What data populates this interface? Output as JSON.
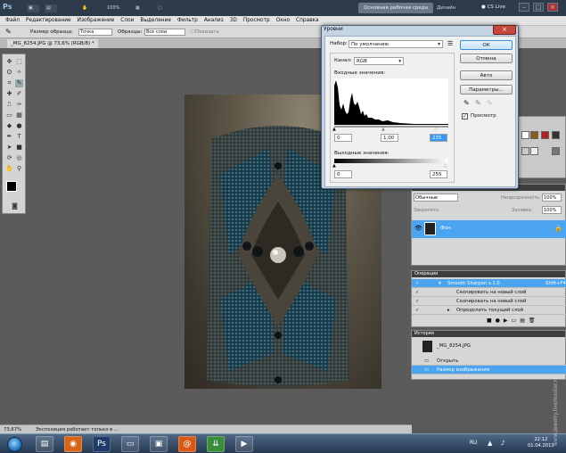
{
  "app": {
    "logo": "Ps",
    "zoom": "100%",
    "workspace_label": "Основная рабочая среда",
    "design_label": "Дизайн",
    "cslive": "CS Live"
  },
  "menu": [
    "Файл",
    "Редактирование",
    "Изображение",
    "Слои",
    "Выделение",
    "Фильтр",
    "Анализ",
    "3D",
    "Просмотр",
    "Окно",
    "Справка"
  ],
  "options": {
    "sample_size_label": "Размер образца:",
    "sample_size_value": "Точка",
    "samples_label": "Образцы:",
    "samples_value": "Все слои",
    "ring_label": "Показать кольцо пробы"
  },
  "document": {
    "tab": "_MG_8254.JPG @ 73,6% (RGB/8) *",
    "zoom": "73,67%",
    "status": "Экспозиция работает только в ..."
  },
  "levels": {
    "title": "Уровни",
    "preset_label": "Набор:",
    "preset_value": "По умолчанию",
    "channel_label": "Канал:",
    "channel_value": "RGB",
    "input_label": "Входные значения:",
    "input_black": "0",
    "input_gamma": "1,00",
    "input_white": "235",
    "output_label": "Выходные значения:",
    "output_black": "0",
    "output_white": "255",
    "ok": "ОК",
    "cancel": "Отмена",
    "auto": "Авто",
    "params": "Параметры...",
    "preview": "Просмотр"
  },
  "layers": {
    "mode": "Обычные",
    "opacity_label": "Непрозрачность:",
    "opacity": "100%",
    "fill_label": "Заливка:",
    "fill": "100%",
    "lock_label": "Закрепить:",
    "layer_name": "Фон"
  },
  "actions": {
    "header": "Операции",
    "rows": [
      {
        "label": "Smooth Sharpen v.1.0",
        "shortcut": "Shift+F4"
      },
      {
        "label": "Скопировать на новый слой",
        "shortcut": ""
      },
      {
        "label": "Скопировать на новый слой",
        "shortcut": ""
      },
      {
        "label": "Определить текущий слой",
        "shortcut": ""
      }
    ]
  },
  "history": {
    "header": "История",
    "snapshot": "_MG_8254.JPG",
    "items": [
      "Открыть",
      "Размер изображения"
    ]
  },
  "taskbar": {
    "lang": "RU",
    "time": "22:12",
    "date": "01.04.2013"
  },
  "watermark": "www.jewelry.livemaster.ru"
}
